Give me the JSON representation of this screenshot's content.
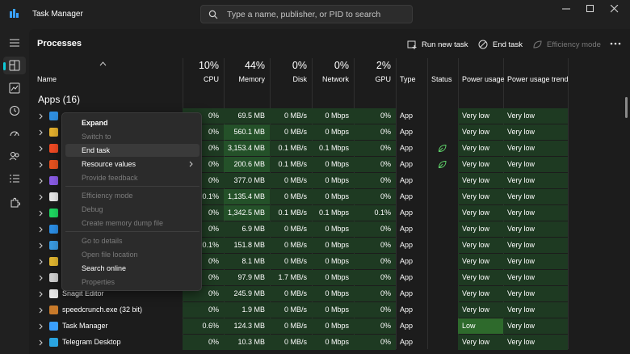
{
  "app": {
    "title": "Task Manager",
    "search_placeholder": "Type a name, publisher, or PID to search"
  },
  "toolbar": {
    "page_title": "Processes",
    "run_new_task": "Run new task",
    "end_task": "End task",
    "efficiency_mode": "Efficiency mode"
  },
  "columns": {
    "name": "Name",
    "cpu": {
      "pct": "10%",
      "label": "CPU"
    },
    "memory": {
      "pct": "44%",
      "label": "Memory"
    },
    "disk": {
      "pct": "0%",
      "label": "Disk"
    },
    "network": {
      "pct": "0%",
      "label": "Network"
    },
    "gpu": {
      "pct": "2%",
      "label": "GPU"
    },
    "type": "Type",
    "status": "Status",
    "power": "Power usage",
    "trend": "Power usage trend"
  },
  "group": {
    "label": "Apps (16)"
  },
  "rows": [
    {
      "name": "",
      "cpu": "0%",
      "mem": "69.5 MB",
      "disk": "0 MB/s",
      "net": "0 Mbps",
      "gpu": "0%",
      "type": "App",
      "power": "Very low",
      "trend": "Very low",
      "icon": "vscode-icon"
    },
    {
      "name": "",
      "cpu": "0%",
      "mem": "560.1 MB",
      "disk": "0 MB/s",
      "net": "0 Mbps",
      "gpu": "0%",
      "type": "App",
      "power": "Very low",
      "trend": "Very low",
      "icon": "chrome-icon"
    },
    {
      "name": "",
      "cpu": "0%",
      "mem": "3,153.4 MB",
      "disk": "0.1 MB/s",
      "net": "0.1 Mbps",
      "gpu": "0%",
      "type": "App",
      "power": "Very low",
      "trend": "Very low",
      "icon": "brave-icon"
    },
    {
      "name": "",
      "cpu": "0%",
      "mem": "200.6 MB",
      "disk": "0.1 MB/s",
      "net": "0 Mbps",
      "gpu": "0%",
      "type": "App",
      "power": "Very low",
      "trend": "Very low",
      "icon": "app-orange-icon"
    },
    {
      "name": "",
      "cpu": "0%",
      "mem": "377.0 MB",
      "disk": "0 MB/s",
      "net": "0 Mbps",
      "gpu": "0%",
      "type": "App",
      "power": "Very low",
      "trend": "Very low",
      "icon": "app-purple-icon"
    },
    {
      "name": "",
      "cpu": "0.1%",
      "mem": "1,135.4 MB",
      "disk": "0 MB/s",
      "net": "0 Mbps",
      "gpu": "0%",
      "type": "App",
      "power": "Very low",
      "trend": "Very low",
      "icon": "mail-icon"
    },
    {
      "name": "",
      "cpu": "0%",
      "mem": "1,342.5 MB",
      "disk": "0.1 MB/s",
      "net": "0.1 Mbps",
      "gpu": "0.1%",
      "type": "App",
      "power": "Very low",
      "trend": "Very low",
      "icon": "spotify-icon"
    },
    {
      "name": "",
      "cpu": "0%",
      "mem": "6.9 MB",
      "disk": "0 MB/s",
      "net": "0 Mbps",
      "gpu": "0%",
      "type": "App",
      "power": "Very low",
      "trend": "Very low",
      "icon": "app-blue-icon"
    },
    {
      "name": "",
      "cpu": "0.1%",
      "mem": "151.8 MB",
      "disk": "0 MB/s",
      "net": "0 Mbps",
      "gpu": "0%",
      "type": "App",
      "power": "Very low",
      "trend": "Very low",
      "icon": "app-grid-icon"
    },
    {
      "name": "",
      "cpu": "0%",
      "mem": "8.1 MB",
      "disk": "0 MB/s",
      "net": "0 Mbps",
      "gpu": "0%",
      "type": "App",
      "power": "Very low",
      "trend": "Very low",
      "icon": "stack-icon"
    },
    {
      "name": "",
      "cpu": "0%",
      "mem": "97.9 MB",
      "disk": "1.7 MB/s",
      "net": "0 Mbps",
      "gpu": "0%",
      "type": "App",
      "power": "Very low",
      "trend": "Very low",
      "icon": "gear-icon"
    },
    {
      "name": "Snagit Editor",
      "cpu": "0%",
      "mem": "245.9 MB",
      "disk": "0 MB/s",
      "net": "0 Mbps",
      "gpu": "0%",
      "type": "App",
      "power": "Very low",
      "trend": "Very low",
      "icon": "snagit-icon"
    },
    {
      "name": "speedcrunch.exe (32 bit)",
      "cpu": "0%",
      "mem": "1.9 MB",
      "disk": "0 MB/s",
      "net": "0 Mbps",
      "gpu": "0%",
      "type": "App",
      "power": "Very low",
      "trend": "Very low",
      "icon": "speedcrunch-icon"
    },
    {
      "name": "Task Manager",
      "cpu": "0.6%",
      "mem": "124.3 MB",
      "disk": "0 MB/s",
      "net": "0 Mbps",
      "gpu": "0%",
      "type": "App",
      "power": "Low",
      "trend": "Very low",
      "icon": "taskmanager-icon"
    },
    {
      "name": "Telegram Desktop",
      "cpu": "0%",
      "mem": "10.3 MB",
      "disk": "0 MB/s",
      "net": "0 Mbps",
      "gpu": "0%",
      "type": "App",
      "power": "Very low",
      "trend": "Very low",
      "icon": "telegram-icon"
    }
  ],
  "context_menu": {
    "items": [
      {
        "label": "Expand",
        "enabled": true
      },
      {
        "label": "Switch to",
        "enabled": false
      },
      {
        "label": "End task",
        "enabled": true
      },
      {
        "label": "Resource values",
        "enabled": true
      },
      {
        "label": "Provide feedback",
        "enabled": false
      },
      {
        "label": "Efficiency mode",
        "enabled": false
      },
      {
        "label": "Debug",
        "enabled": false
      },
      {
        "label": "Create memory dump file",
        "enabled": false
      },
      {
        "label": "Go to details",
        "enabled": false
      },
      {
        "label": "Open file location",
        "enabled": false
      },
      {
        "label": "Search online",
        "enabled": true
      },
      {
        "label": "Properties",
        "enabled": false
      }
    ]
  },
  "colors": {
    "accent": "#0fcad8",
    "heat_light": "#1e3a22",
    "heat_mid": "#245129",
    "heat_low_power": "#2e6a2c",
    "text_disabled": "#7a7a7a"
  }
}
